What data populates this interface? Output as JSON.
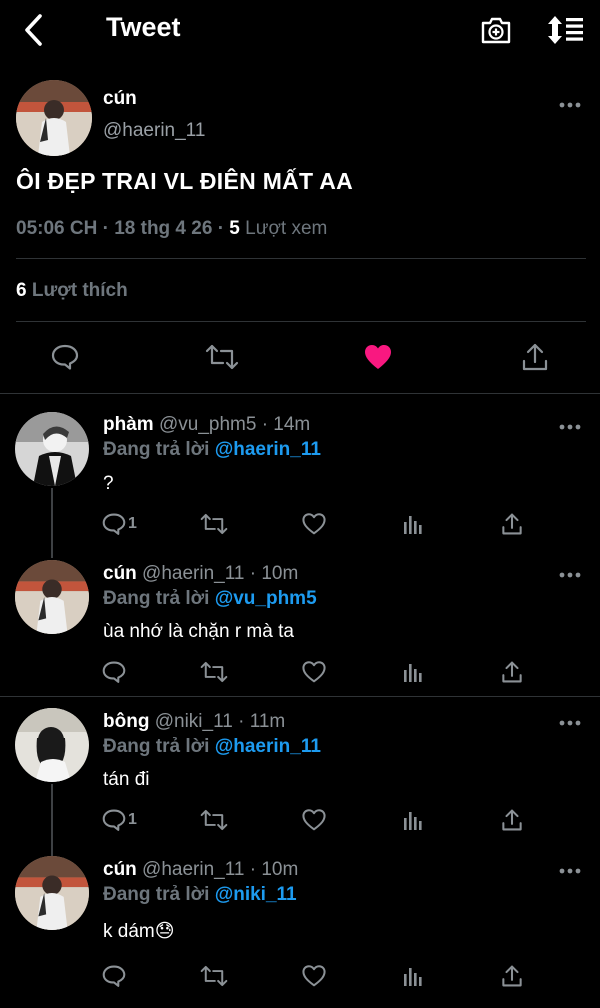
{
  "header": {
    "title": "Tweet"
  },
  "main_tweet": {
    "name": "cún",
    "handle": "@haerin_11",
    "text": "ÔI ĐẸP TRAI VL ĐIÊN MẤT AA",
    "time": "05:06 CH · 18 thg 4 26 · ",
    "views_count": "5",
    "views_label": " Lượt xem",
    "likes_count": "6",
    "likes_label": " Lượt thích",
    "liked": true,
    "like_color": "#f91880"
  },
  "replies": [
    {
      "name": "phàm",
      "handle": " @vu_phm5 · 14m",
      "replying_label": "Đang trả lời ",
      "replying_to": "@haerin_11",
      "text": "?",
      "reply_count": "1"
    },
    {
      "name": "cún",
      "handle": " @haerin_11 · 10m",
      "replying_label": "Đang trả lời ",
      "replying_to": "@vu_phm5",
      "text": "ùa nhớ là chặn r mà ta",
      "reply_count": ""
    },
    {
      "name": "bông",
      "handle": " @niki_11 · 11m",
      "replying_label": "Đang trả lời ",
      "replying_to": "@haerin_11",
      "text": "tán đi",
      "reply_count": "1"
    },
    {
      "name": "cún",
      "handle": " @haerin_11 · 10m",
      "replying_label": "Đang trả lời ",
      "replying_to": "@niki_11",
      "text": "k dám😓",
      "reply_count": ""
    }
  ],
  "colors": {
    "accent": "#1d9bf0",
    "muted": "#6e767d",
    "background": "#000000"
  }
}
